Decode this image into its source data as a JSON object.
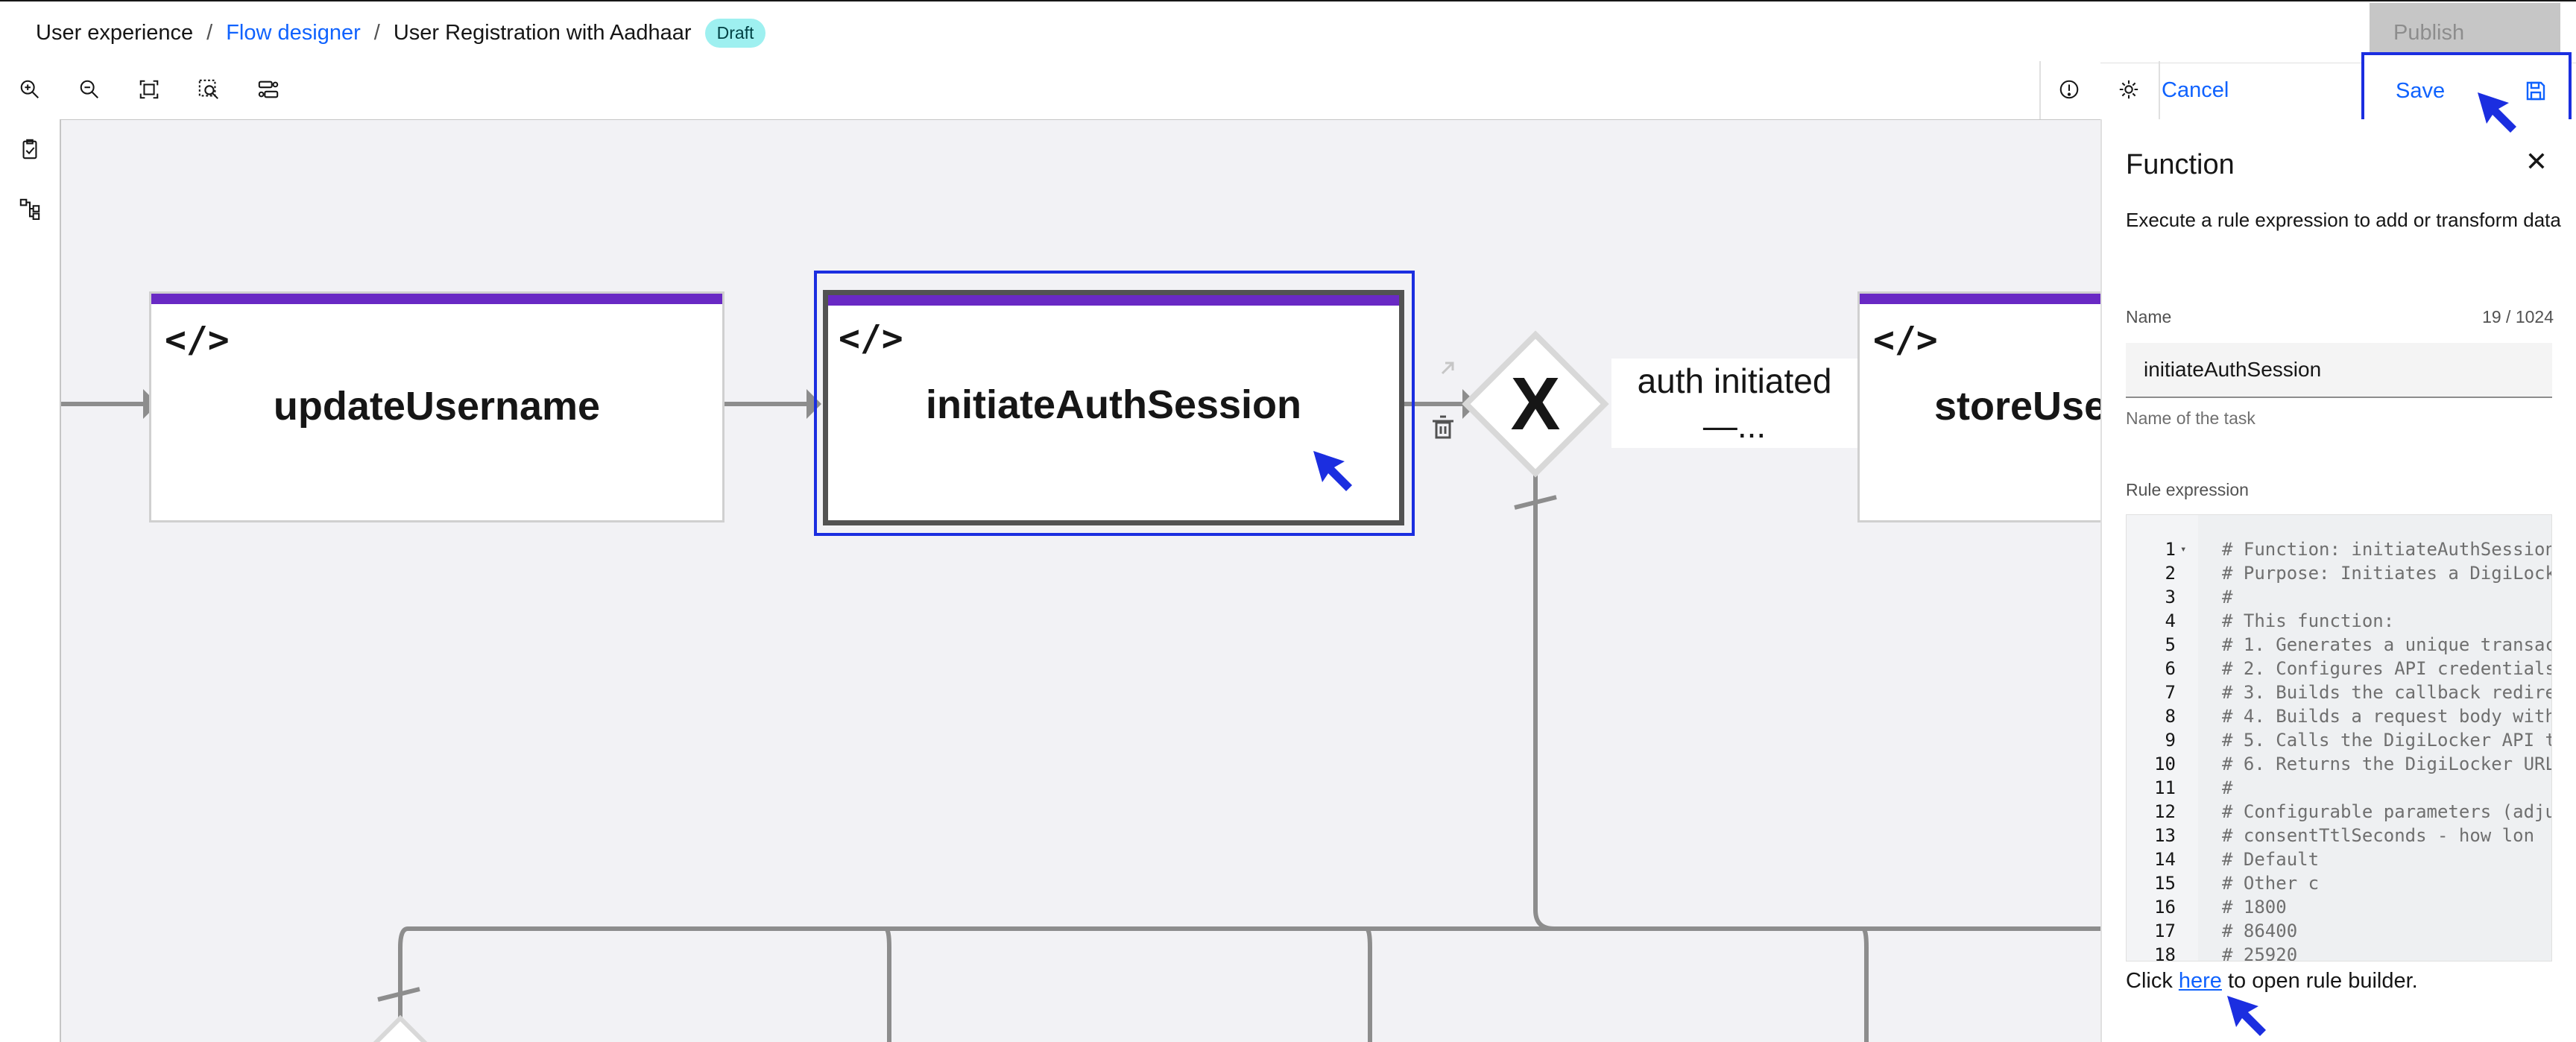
{
  "breadcrumb": {
    "items": [
      "User experience",
      "Flow designer",
      "User Registration with Aadhaar"
    ],
    "separator": "/",
    "badge": "Draft"
  },
  "header": {
    "publish_label": "Publish"
  },
  "toolbar": {
    "icons": [
      "zoom-in-icon",
      "zoom-out-icon",
      "fit-to-screen-icon",
      "zoom-to-selection-icon",
      "auto-layout-icon",
      "info-icon",
      "settings-icon"
    ],
    "cancel_label": "Cancel",
    "save_label": "Save"
  },
  "sidebar": {
    "icons": [
      "task-checklist-icon",
      "flow-tree-icon"
    ]
  },
  "canvas": {
    "nodes": [
      {
        "code_icon": "</>",
        "title": "updateUsername"
      },
      {
        "code_icon": "</>",
        "title": "initiateAuthSession"
      },
      {
        "code_icon": "</>",
        "title": "storeUse"
      }
    ],
    "gateway_symbol": "X",
    "gateway_label_line1": "auth initiated",
    "gateway_label_line2": "—..."
  },
  "panel": {
    "title": "Function",
    "description": "Execute a rule expression to add or transform data",
    "name_label": "Name",
    "name_count": "19 / 1024",
    "name_value": "initiateAuthSession",
    "name_helper": "Name of the task",
    "rule_label": "Rule expression",
    "code_lines": [
      {
        "n": "1",
        "text": "# Function: initiateAuthSession"
      },
      {
        "n": "2",
        "text": "# Purpose: Initiates a DigiLock"
      },
      {
        "n": "3",
        "text": "#"
      },
      {
        "n": "4",
        "text": "# This function:"
      },
      {
        "n": "5",
        "text": "# 1. Generates a unique transac"
      },
      {
        "n": "6",
        "text": "# 2. Configures API credentials"
      },
      {
        "n": "7",
        "text": "# 3. Builds the callback redire"
      },
      {
        "n": "8",
        "text": "# 4. Builds a request body with"
      },
      {
        "n": "9",
        "text": "# 5. Calls the DigiLocker API t"
      },
      {
        "n": "10",
        "text": "# 6. Returns the DigiLocker URL"
      },
      {
        "n": "11",
        "text": "#"
      },
      {
        "n": "12",
        "text": "# Configurable parameters (adju"
      },
      {
        "n": "13",
        "text": "#   consentTtlSeconds - how lon"
      },
      {
        "n": "14",
        "text": "#                       Default"
      },
      {
        "n": "15",
        "text": "#                       Other c"
      },
      {
        "n": "16",
        "text": "#                         1800 "
      },
      {
        "n": "17",
        "text": "#                         86400"
      },
      {
        "n": "18",
        "text": "#                         25920"
      }
    ],
    "builder_prefix": "Click ",
    "builder_link": "here",
    "builder_suffix": " to open rule builder."
  },
  "colors": {
    "accent": "#0f62fe",
    "annotation_blue": "#1b2ee0",
    "node_bar": "#6929c4",
    "badge": "#9ef0f0"
  }
}
